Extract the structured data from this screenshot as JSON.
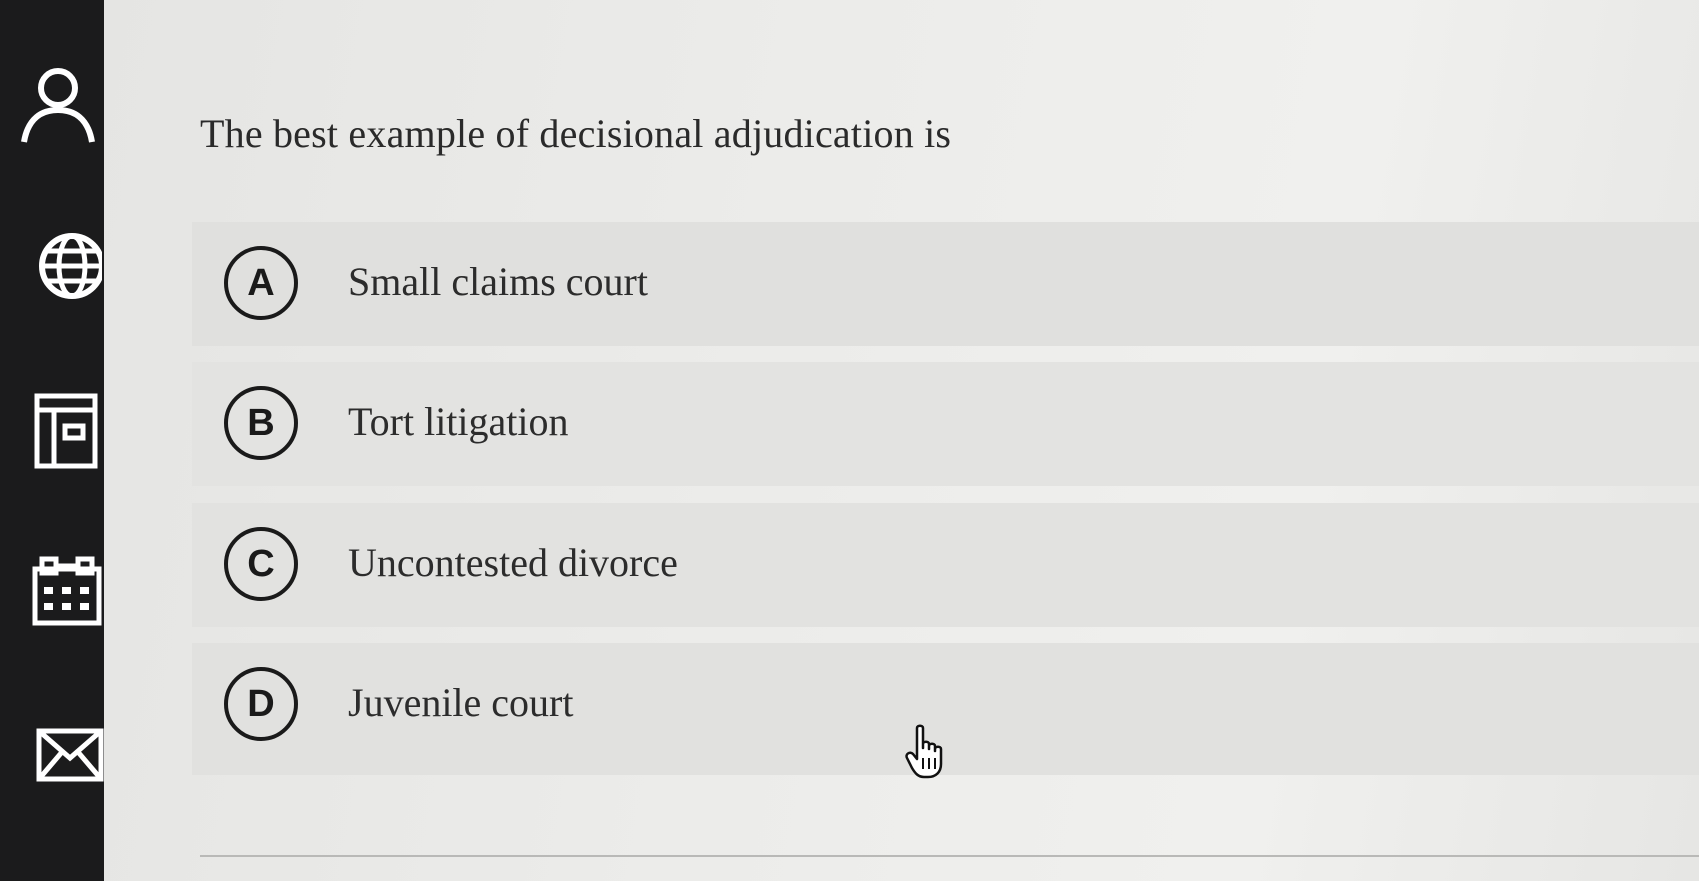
{
  "sidebar": {
    "icons": [
      "person-icon",
      "globe-icon",
      "layout-icon",
      "calendar-icon",
      "mail-icon"
    ]
  },
  "question": {
    "text": "The best example of decisional adjudication is"
  },
  "options": [
    {
      "letter": "A",
      "label": "Small claims court"
    },
    {
      "letter": "B",
      "label": "Tort litigation"
    },
    {
      "letter": "C",
      "label": "Uncontested divorce"
    },
    {
      "letter": "D",
      "label": "Juvenile court"
    }
  ],
  "cursor": {
    "icon": "hand-pointer-icon"
  }
}
